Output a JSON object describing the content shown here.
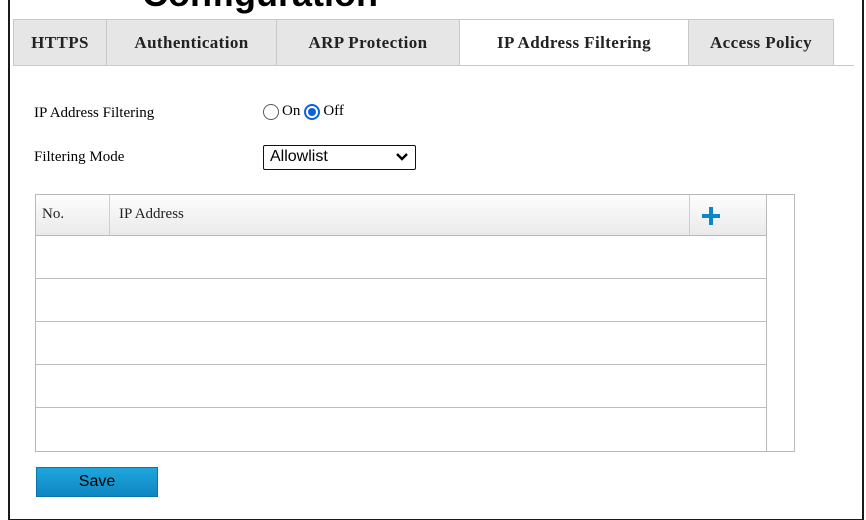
{
  "tabs": [
    {
      "label": "HTTPS",
      "active": false
    },
    {
      "label": "Authentication",
      "active": false
    },
    {
      "label": "ARP Protection",
      "active": false
    },
    {
      "label": "IP Address Filtering",
      "active": true
    },
    {
      "label": "Access Policy",
      "active": false
    }
  ],
  "form": {
    "filtering_label": "IP Address Filtering",
    "on_label": "On",
    "off_label": "Off",
    "selected": "Off",
    "mode_label": "Filtering Mode",
    "mode_value": "Allowlist"
  },
  "table": {
    "col_no": "No.",
    "col_ip": "IP Address",
    "add_icon": "plus-icon",
    "rows": []
  },
  "actions": {
    "save_label": "Save"
  },
  "colors": {
    "accent": "#0b63d8",
    "save_button": "#1597d0",
    "add_icon": "#0a88c6"
  }
}
